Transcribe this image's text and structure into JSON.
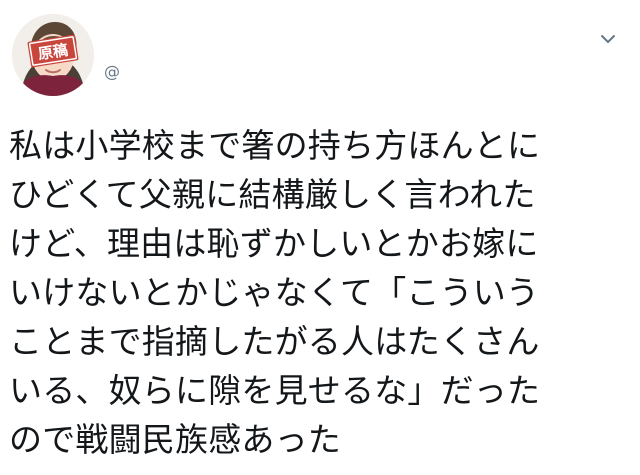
{
  "author": {
    "avatar_label": "原稿",
    "handle": "@"
  },
  "menu": {
    "icon": "chevron-down-icon"
  },
  "tweet": {
    "lines": [
      "私は小学校まで箸の持ち方ほんとに",
      "ひどくて父親に結構厳しく言われた",
      "けど、理由は恥ずかしいとかお嫁に",
      "いけないとかじゃなくて「こういう",
      "ことまで指摘したがる人はたくさん",
      "いる、奴らに隙を見せるな」だった",
      "ので戦闘民族感あった"
    ]
  },
  "colors": {
    "background": "#ffffff",
    "text": "#14171a",
    "secondary_text": "#657786",
    "avatar_badge": "#c9463d"
  }
}
